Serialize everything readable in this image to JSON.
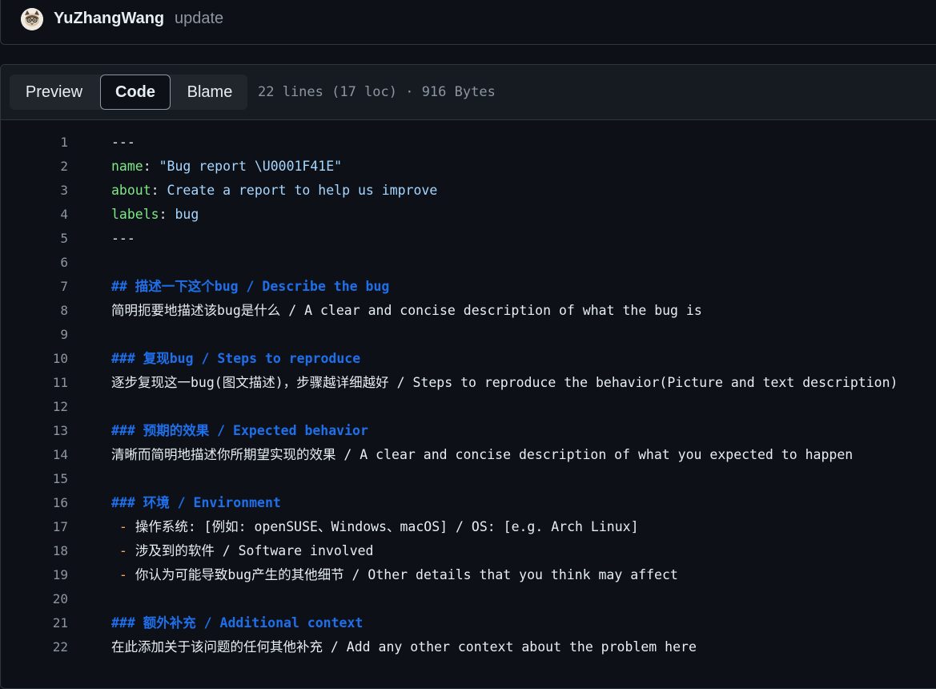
{
  "commit": {
    "author": "YuZhangWang",
    "message": "update"
  },
  "tabs": [
    {
      "label": "Preview",
      "active": false
    },
    {
      "label": "Code",
      "active": true
    },
    {
      "label": "Blame",
      "active": false
    }
  ],
  "file_info": "22 lines (17 loc) · 916 Bytes",
  "lines": [
    {
      "n": "1",
      "text": "---"
    },
    {
      "n": "2",
      "key": "name",
      "sep": ": ",
      "value": "\"Bug report \\U0001F41E\""
    },
    {
      "n": "3",
      "key": "about",
      "sep": ": ",
      "value": "Create a report to help us improve"
    },
    {
      "n": "4",
      "key": "labels",
      "sep": ": ",
      "value": "bug"
    },
    {
      "n": "5",
      "text": "---"
    },
    {
      "n": "6",
      "text": ""
    },
    {
      "n": "7",
      "heading": "## 描述一下这个bug / Describe the bug"
    },
    {
      "n": "8",
      "text": "简明扼要地描述该bug是什么 / A clear and concise description of what the bug is"
    },
    {
      "n": "9",
      "text": ""
    },
    {
      "n": "10",
      "heading": "### 复现bug / Steps to reproduce"
    },
    {
      "n": "11",
      "text": "逐步复现这一bug(图文描述)，步骤越详细越好 / Steps to reproduce the behavior(Picture and text description)"
    },
    {
      "n": "12",
      "text": ""
    },
    {
      "n": "13",
      "heading": "### 预期的效果 / Expected behavior"
    },
    {
      "n": "14",
      "text": "清晰而简明地描述你所期望实现的效果 / A clear and concise description of what you expected to happen"
    },
    {
      "n": "15",
      "text": ""
    },
    {
      "n": "16",
      "heading": "### 环境 / Environment"
    },
    {
      "n": "17",
      "bullet": " - ",
      "text": "操作系统: [例如: openSUSE、Windows、macOS] / OS: [e.g. Arch Linux]"
    },
    {
      "n": "18",
      "bullet": " - ",
      "text": "涉及到的软件 / Software involved"
    },
    {
      "n": "19",
      "bullet": " - ",
      "text": "你认为可能导致bug产生的其他细节 / Other details that you think may affect"
    },
    {
      "n": "20",
      "text": ""
    },
    {
      "n": "21",
      "heading": "### 额外补充 / Additional context"
    },
    {
      "n": "22",
      "text": "在此添加关于该问题的任何其他补充 / Add any other context about the problem here"
    }
  ]
}
